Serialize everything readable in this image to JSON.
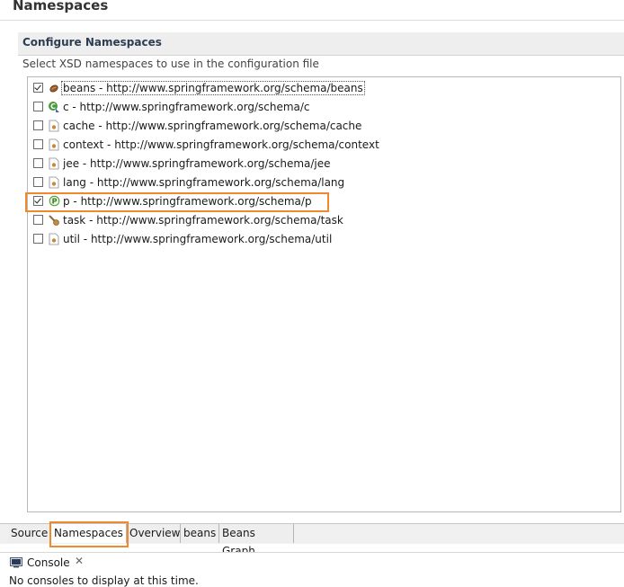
{
  "editor": {
    "title": "Namespaces"
  },
  "section": {
    "title": "Configure Namespaces",
    "description": "Select XSD namespaces to use in the configuration file"
  },
  "namespaces": [
    {
      "label": "beans - http://www.springframework.org/schema/beans",
      "checked": true,
      "icon": "bean-icon"
    },
    {
      "label": "c - http://www.springframework.org/schema/c",
      "checked": false,
      "icon": "c-namespace-icon"
    },
    {
      "label": "cache - http://www.springframework.org/schema/cache",
      "checked": false,
      "icon": "xml-file-icon"
    },
    {
      "label": "context - http://www.springframework.org/schema/context",
      "checked": false,
      "icon": "xml-file-icon"
    },
    {
      "label": "jee - http://www.springframework.org/schema/jee",
      "checked": false,
      "icon": "xml-file-icon"
    },
    {
      "label": "lang - http://www.springframework.org/schema/lang",
      "checked": false,
      "icon": "xml-file-icon"
    },
    {
      "label": "p - http://www.springframework.org/schema/p",
      "checked": true,
      "icon": "p-namespace-icon"
    },
    {
      "label": "task - http://www.springframework.org/schema/task",
      "checked": false,
      "icon": "task-icon"
    },
    {
      "label": "util - http://www.springframework.org/schema/util",
      "checked": false,
      "icon": "xml-file-icon"
    }
  ],
  "tabs": [
    "Source",
    "Namespaces",
    "Overview",
    "beans",
    "Beans Graph"
  ],
  "active_tab": "Namespaces",
  "console": {
    "label": "Console",
    "close": "✕",
    "message": "No consoles to display at this time."
  },
  "colors": {
    "highlight": "#f0882d",
    "section_title": "#2d3e53"
  }
}
